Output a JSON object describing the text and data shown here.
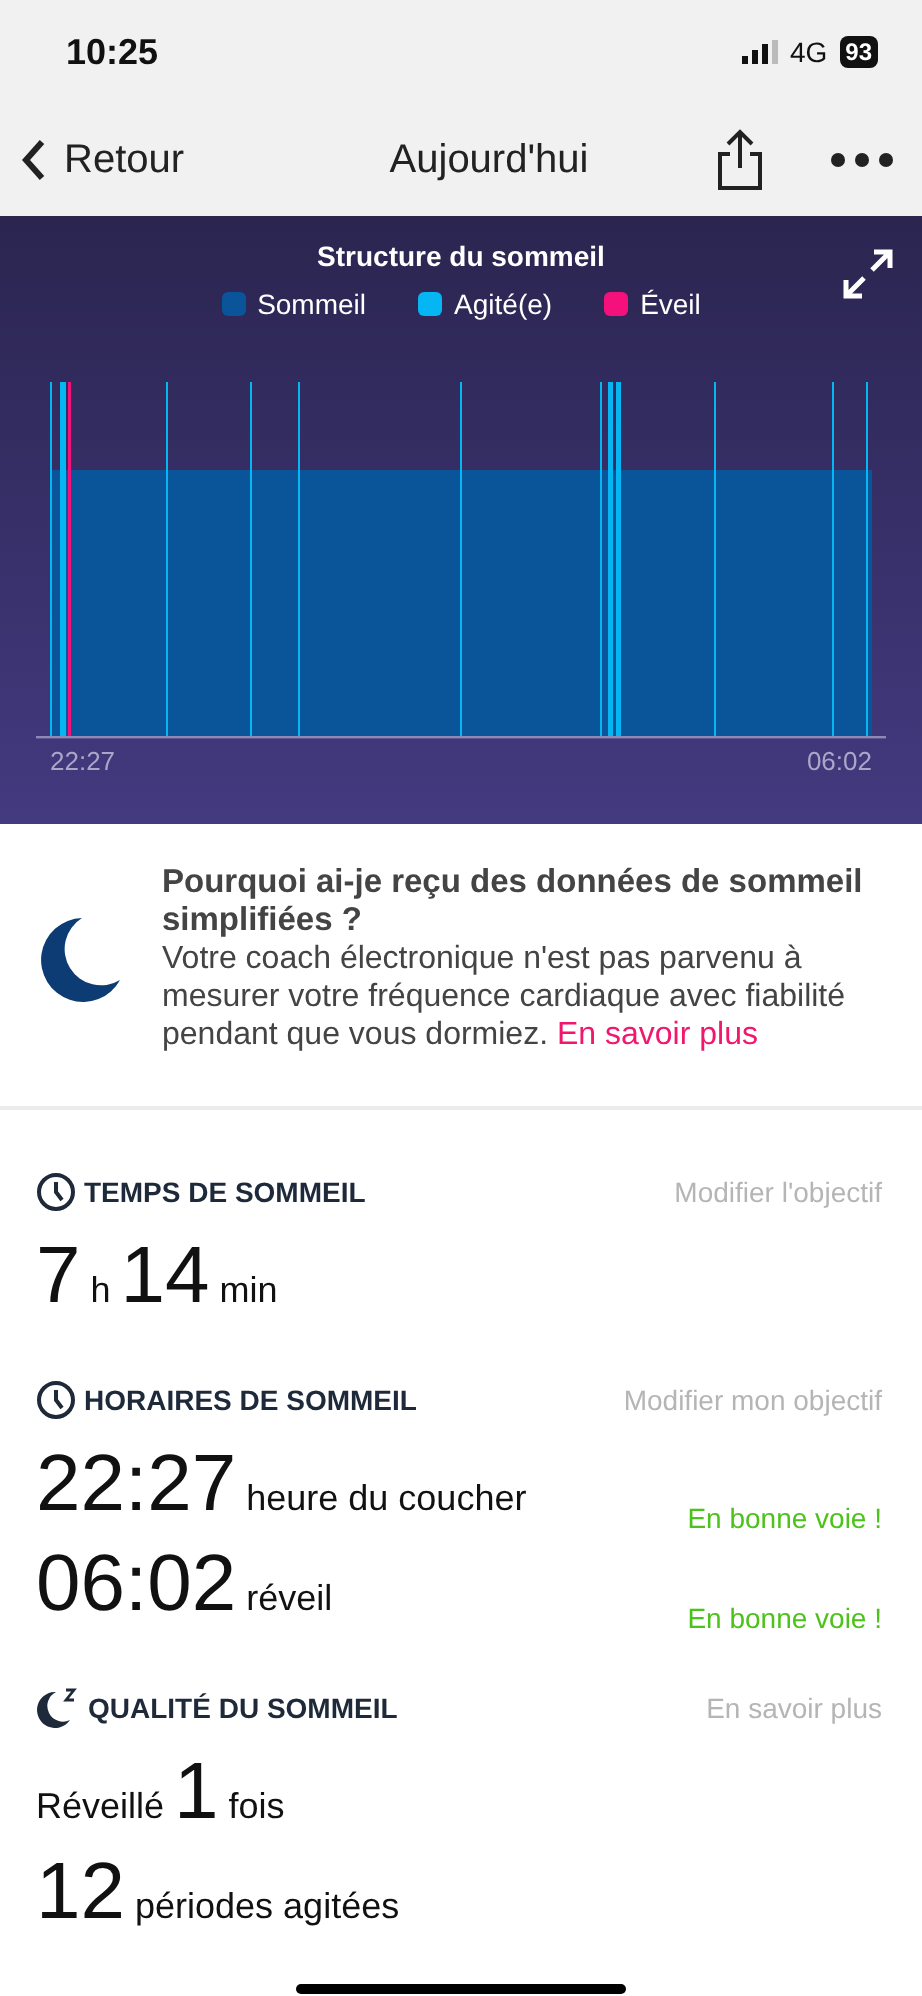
{
  "status_bar": {
    "time": "10:25",
    "network": "4G",
    "battery": "93"
  },
  "nav": {
    "back": "Retour",
    "title": "Aujourd'hui"
  },
  "chart": {
    "title": "Structure du sommeil",
    "legend": [
      {
        "label": "Sommeil",
        "color": "#0a5499"
      },
      {
        "label": "Agité(e)",
        "color": "#05b6f2"
      },
      {
        "label": "Éveil",
        "color": "#f5117b"
      }
    ],
    "start": "22:27",
    "end": "06:02"
  },
  "notice": {
    "title": "Pourquoi ai-je reçu des données de sommeil simplifiées ?",
    "body": "Votre coach électronique n'est pas parvenu à mesurer votre fréquence cardiaque avec fiabilité pendant que vous dormiez.",
    "link": "En savoir plus"
  },
  "sections": [
    {
      "kind": "duration",
      "title": "TEMPS DE SOMMEIL",
      "action": "Modifier l'objectif",
      "rows": [
        {
          "parts": [
            {
              "text": "7",
              "big": true
            },
            {
              "text": "h",
              "big": false
            },
            {
              "text": "14",
              "big": true
            },
            {
              "text": "min",
              "big": false
            }
          ]
        }
      ]
    },
    {
      "kind": "schedule",
      "title": "HORAIRES DE SOMMEIL",
      "action": "Modifier mon objectif",
      "rows": [
        {
          "parts": [
            {
              "text": "22:27",
              "big": true
            },
            {
              "text": "heure du coucher",
              "big": false
            }
          ],
          "status": "En bonne voie !"
        },
        {
          "parts": [
            {
              "text": "06:02",
              "big": true
            },
            {
              "text": "réveil",
              "big": false
            }
          ],
          "status": "En bonne voie !"
        }
      ]
    },
    {
      "kind": "quality",
      "title": "QUALITÉ DU SOMMEIL",
      "action": "En savoir plus",
      "rows": [
        {
          "parts": [
            {
              "text": "Réveillé",
              "big": false
            },
            {
              "text": "1",
              "big": true
            },
            {
              "text": "fois",
              "big": false
            }
          ]
        },
        {
          "parts": [
            {
              "text": "12",
              "big": true
            },
            {
              "text": "périodes agitées",
              "big": false
            }
          ]
        }
      ]
    }
  ]
}
